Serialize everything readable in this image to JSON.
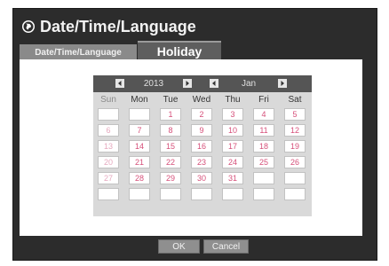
{
  "title": "Date/Time/Language",
  "tabs": [
    {
      "label": "Date/Time/Language"
    },
    {
      "label": "Holiday"
    }
  ],
  "calendar": {
    "year": "2013",
    "month": "Jan",
    "weekdays": [
      "Sun",
      "Mon",
      "Tue",
      "Wed",
      "Thu",
      "Fri",
      "Sat"
    ],
    "weeks": [
      [
        "",
        "",
        "1",
        "2",
        "3",
        "4",
        "5"
      ],
      [
        "6",
        "7",
        "8",
        "9",
        "10",
        "11",
        "12"
      ],
      [
        "13",
        "14",
        "15",
        "16",
        "17",
        "18",
        "19"
      ],
      [
        "20",
        "21",
        "22",
        "23",
        "24",
        "25",
        "26"
      ],
      [
        "27",
        "28",
        "29",
        "30",
        "31",
        "",
        ""
      ],
      [
        "",
        "",
        "",
        "",
        "",
        "",
        ""
      ]
    ]
  },
  "buttons": {
    "ok": "OK",
    "cancel": "Cancel"
  },
  "colors": {
    "dialog_bg": "#2c2c2c",
    "day_text": "#d6507a",
    "sunday_text": "#e6a9bf"
  },
  "icons": {
    "title": "globe-icon",
    "prev": "arrow-left-icon",
    "next": "arrow-right-icon"
  }
}
